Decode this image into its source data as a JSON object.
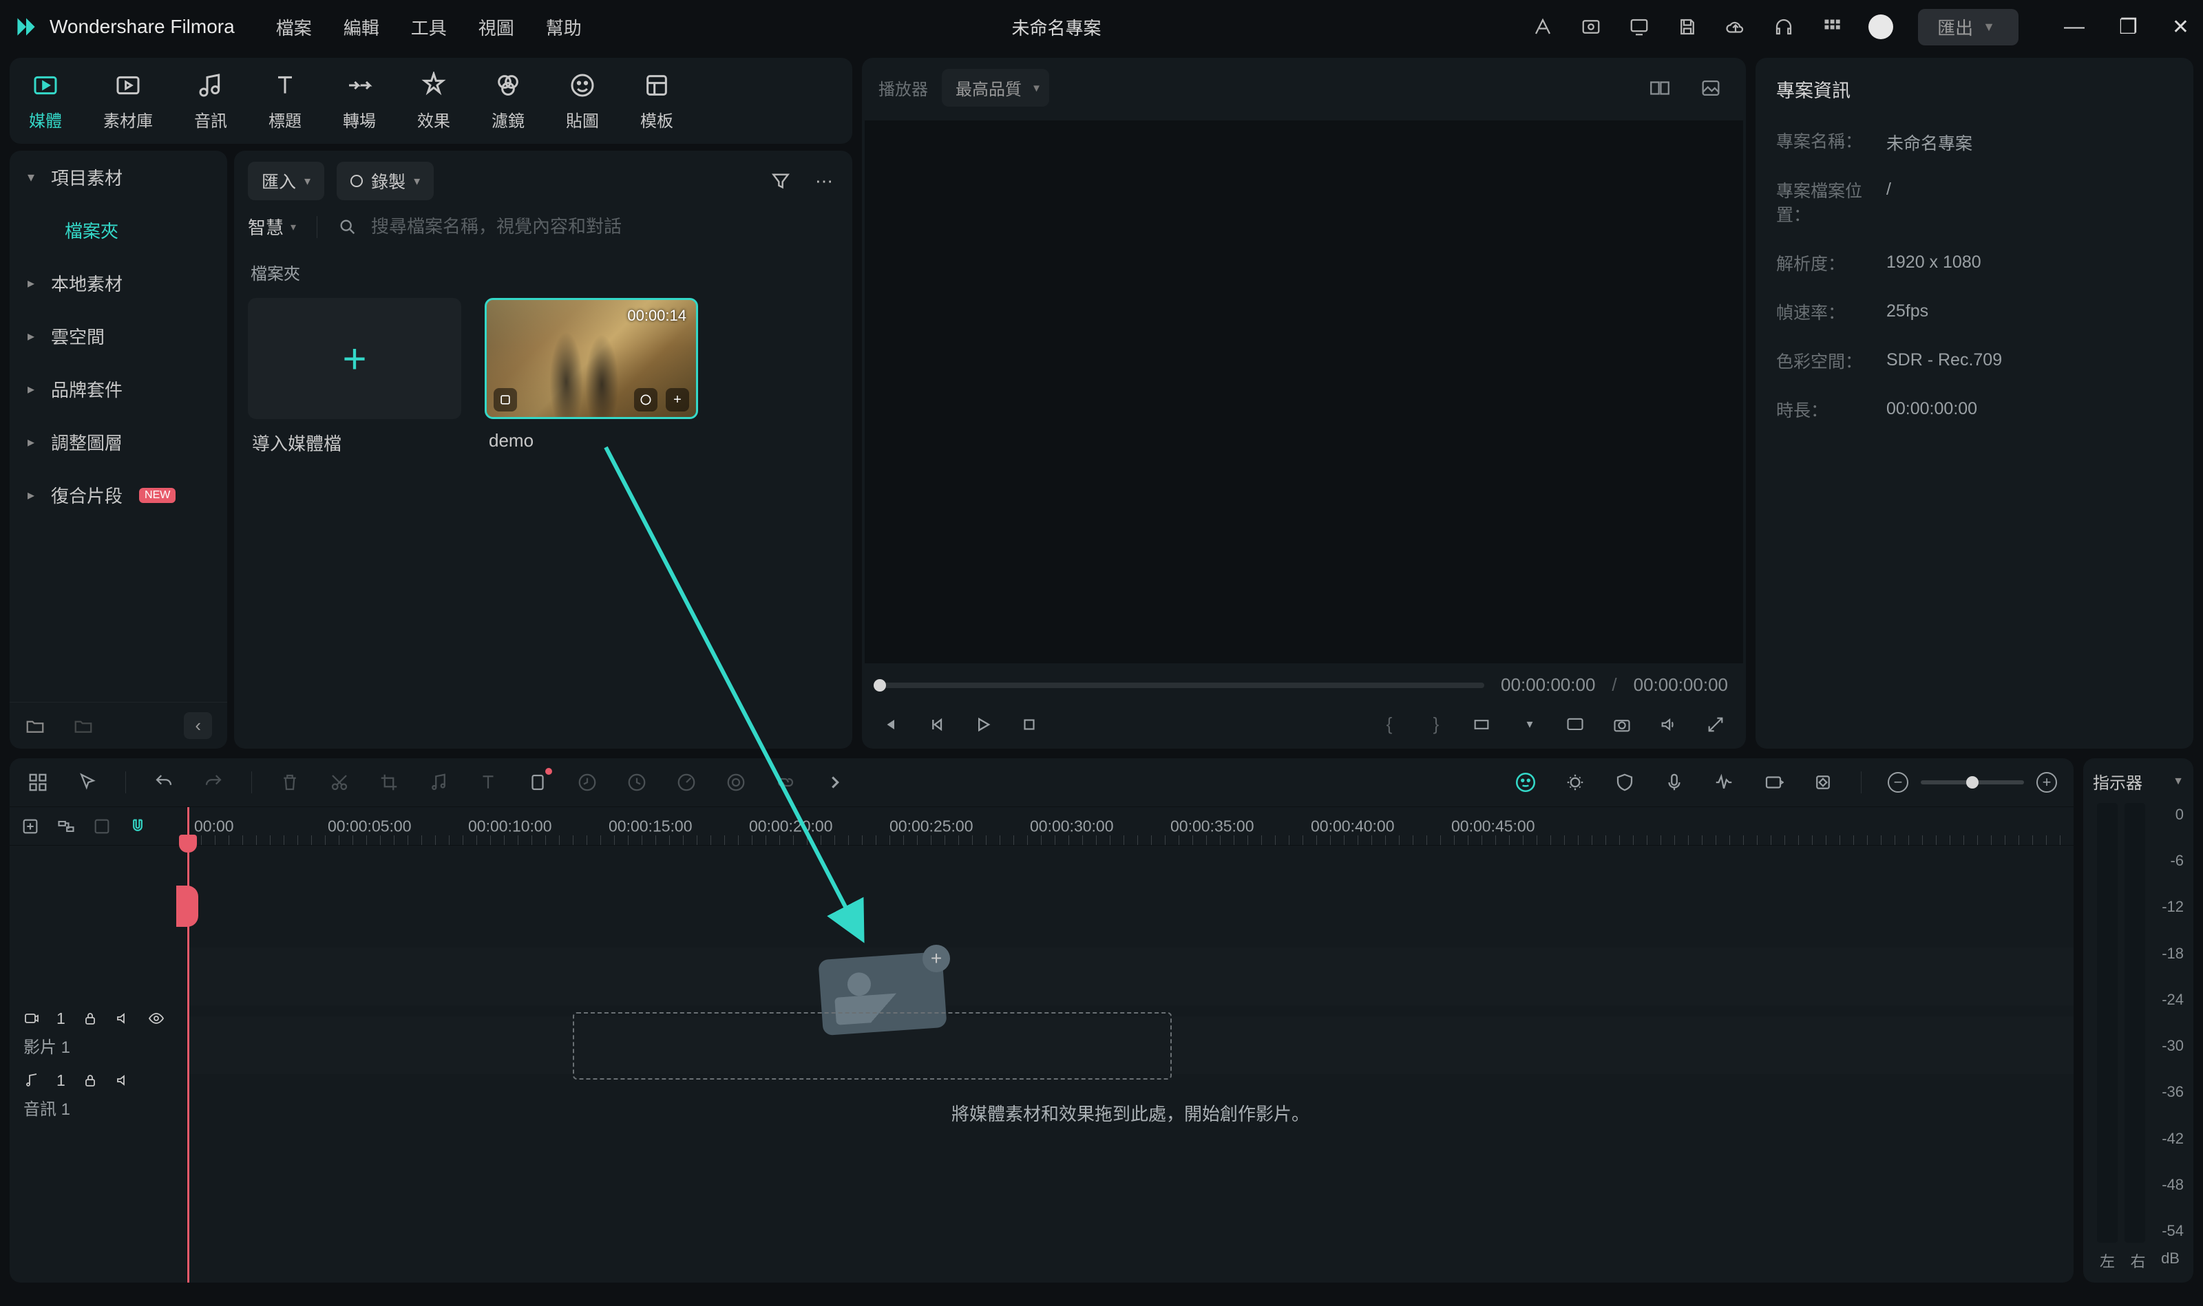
{
  "app": {
    "name": "Wondershare Filmora",
    "project_title": "未命名專案",
    "export_label": "匯出"
  },
  "menu": [
    "檔案",
    "編輯",
    "工具",
    "視圖",
    "幫助"
  ],
  "tool_tabs": [
    {
      "id": "media",
      "label": "媒體"
    },
    {
      "id": "stock",
      "label": "素材庫"
    },
    {
      "id": "audio",
      "label": "音訊"
    },
    {
      "id": "title",
      "label": "標題"
    },
    {
      "id": "transition",
      "label": "轉場"
    },
    {
      "id": "effect",
      "label": "效果"
    },
    {
      "id": "filter",
      "label": "濾鏡"
    },
    {
      "id": "sticker",
      "label": "貼圖"
    },
    {
      "id": "template",
      "label": "模板"
    }
  ],
  "sidebar": {
    "items": [
      {
        "label": "項目素材",
        "expandable": true,
        "expanded": true
      },
      {
        "label": "檔案夾",
        "sub": true,
        "active": true
      },
      {
        "label": "本地素材",
        "expandable": true
      },
      {
        "label": "雲空間",
        "expandable": true
      },
      {
        "label": "品牌套件",
        "expandable": true
      },
      {
        "label": "調整圖層",
        "expandable": true
      },
      {
        "label": "復合片段",
        "expandable": true,
        "new": true
      }
    ],
    "new_badge": "NEW"
  },
  "browser": {
    "import_btn": "匯入",
    "record_btn": "錄製",
    "smart_label": "智慧",
    "search_placeholder": "搜尋檔案名稱，視覺內容和對話",
    "section_label": "檔案夾",
    "import_card_label": "導入媒體檔",
    "clip": {
      "name": "demo",
      "duration": "00:00:14"
    }
  },
  "player": {
    "label": "播放器",
    "quality": "最高品質",
    "time_current": "00:00:00:00",
    "time_total": "00:00:00:00"
  },
  "info": {
    "title": "專案資訊",
    "rows": [
      {
        "k": "專案名稱：",
        "v": "未命名專案"
      },
      {
        "k": "專案檔案位置：",
        "v": "/"
      },
      {
        "k": "解析度：",
        "v": "1920 x 1080"
      },
      {
        "k": "幀速率：",
        "v": "25fps"
      },
      {
        "k": "色彩空間：",
        "v": "SDR - Rec.709"
      },
      {
        "k": "時長：",
        "v": "00:00:00:00"
      }
    ]
  },
  "timeline": {
    "ruler": [
      "00:00",
      "00:00:05:00",
      "00:00:10:00",
      "00:00:15:00",
      "00:00:20:00",
      "00:00:25:00",
      "00:00:30:00",
      "00:00:35:00",
      "00:00:40:00",
      "00:00:45:00"
    ],
    "drop_hint": "將媒體素材和效果拖到此處，開始創作影片。",
    "track_video": {
      "icon_count": "1",
      "name": "影片 1"
    },
    "track_audio": {
      "icon_count": "1",
      "name": "音訊 1"
    },
    "indicator_label": "指示器"
  },
  "meters": {
    "scale": [
      "0",
      "-6",
      "-12",
      "-18",
      "-24",
      "-30",
      "-36",
      "-42",
      "-48",
      "-54"
    ],
    "unit": "dB",
    "left": "左",
    "right": "右"
  }
}
